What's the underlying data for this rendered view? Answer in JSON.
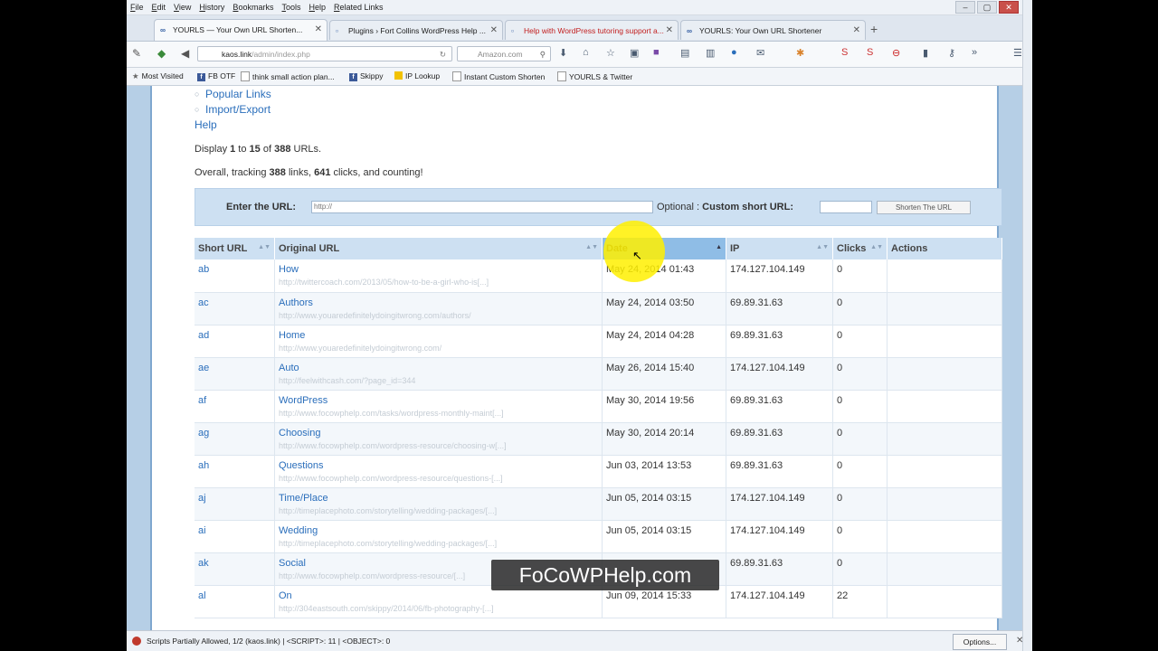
{
  "menu": [
    "File",
    "Edit",
    "View",
    "History",
    "Bookmarks",
    "Tools",
    "Help",
    "Related Links"
  ],
  "tabs": [
    {
      "label": "YOURLS — Your Own URL Shorten...",
      "icon": "∞"
    },
    {
      "label": "Plugins › Fort Collins WordPress Help ...",
      "icon": ""
    },
    {
      "label": "Help with WordPress tutoring support a...",
      "icon": ""
    },
    {
      "label": "YOURLS: Your Own URL Shortener",
      "icon": "∞"
    }
  ],
  "address": {
    "domain": "kaos.link",
    "path": "/admin/index.php"
  },
  "search": {
    "placeholder": "Amazon.com"
  },
  "bookmarks": [
    "Most Visited",
    "FB OTF",
    "think small action plan...",
    "Skippy",
    "IP Lookup",
    "Instant Custom Shorten",
    "YOURLS & Twitter"
  ],
  "nav": {
    "popular": "Popular Links",
    "import": "Import/Export",
    "help": "Help"
  },
  "summary": {
    "display_prefix": "Display ",
    "display_from": "1",
    "display_mid": " to ",
    "display_to": "15",
    "display_of": " of ",
    "display_total": "388",
    "display_suffix": " URLs.",
    "overall_prefix": "Overall, tracking ",
    "links": "388",
    "links_label": " links, ",
    "clicks": "641",
    "clicks_label": " clicks, and counting!"
  },
  "form": {
    "enter_label": "Enter the URL:",
    "url_placeholder": "http://",
    "optional": "Optional",
    "custom_label": "Custom short URL:",
    "button": "Shorten The URL"
  },
  "table": {
    "headers": [
      "Short URL",
      "Original URL",
      "Date",
      "IP",
      "Clicks",
      "Actions"
    ],
    "rows": [
      {
        "kw": "ab",
        "title": "How",
        "url": "http://twittercoach.com/2013/05/how-to-be-a-girl-who-is[...]",
        "date": "May 24, 2014 01:43",
        "ip": "174.127.104.149",
        "clicks": "0"
      },
      {
        "kw": "ac",
        "title": "Authors",
        "url": "http://www.youaredefinitelydoingitwrong.com/authors/",
        "date": "May 24, 2014 03:50",
        "ip": "69.89.31.63",
        "clicks": "0"
      },
      {
        "kw": "ad",
        "title": "Home",
        "url": "http://www.youaredefinitelydoingitwrong.com/",
        "date": "May 24, 2014 04:28",
        "ip": "69.89.31.63",
        "clicks": "0"
      },
      {
        "kw": "ae",
        "title": "Auto",
        "url": "http://feelwithcash.com/?page_id=344",
        "date": "May 26, 2014 15:40",
        "ip": "174.127.104.149",
        "clicks": "0"
      },
      {
        "kw": "af",
        "title": "WordPress",
        "url": "http://www.focowphelp.com/tasks/wordpress-monthly-maint[...]",
        "date": "May 30, 2014 19:56",
        "ip": "69.89.31.63",
        "clicks": "0"
      },
      {
        "kw": "ag",
        "title": "Choosing",
        "url": "http://www.focowphelp.com/wordpress-resource/choosing-w[...]",
        "date": "May 30, 2014 20:14",
        "ip": "69.89.31.63",
        "clicks": "0"
      },
      {
        "kw": "ah",
        "title": "Questions",
        "url": "http://www.focowphelp.com/wordpress-resource/questions-[...]",
        "date": "Jun 03, 2014 13:53",
        "ip": "69.89.31.63",
        "clicks": "0"
      },
      {
        "kw": "aj",
        "title": "Time/Place",
        "url": "http://timeplacephoto.com/storytelling/wedding-packages/[...]",
        "date": "Jun 05, 2014 03:15",
        "ip": "174.127.104.149",
        "clicks": "0"
      },
      {
        "kw": "ai",
        "title": "Wedding",
        "url": "http://timeplacephoto.com/storytelling/wedding-packages/[...]",
        "date": "Jun 05, 2014 03:15",
        "ip": "174.127.104.149",
        "clicks": "0"
      },
      {
        "kw": "ak",
        "title": "Social",
        "url": "http://www.focowphelp.com/wordpress-resource/[...]",
        "date": "",
        "ip": "69.89.31.63",
        "clicks": "0"
      },
      {
        "kw": "al",
        "title": "On",
        "url": "http://304eastsouth.com/skippy/2014/06/fb-photography-[...]",
        "date": "Jun 09, 2014 15:33",
        "ip": "174.127.104.149",
        "clicks": "22"
      }
    ]
  },
  "watermark": "FoCoWPHelp.com",
  "status": {
    "text": "Scripts Partially Allowed, 1/2 (kaos.link) | <SCRIPT>: 11 | <OBJECT>: 0",
    "options": "Options..."
  }
}
